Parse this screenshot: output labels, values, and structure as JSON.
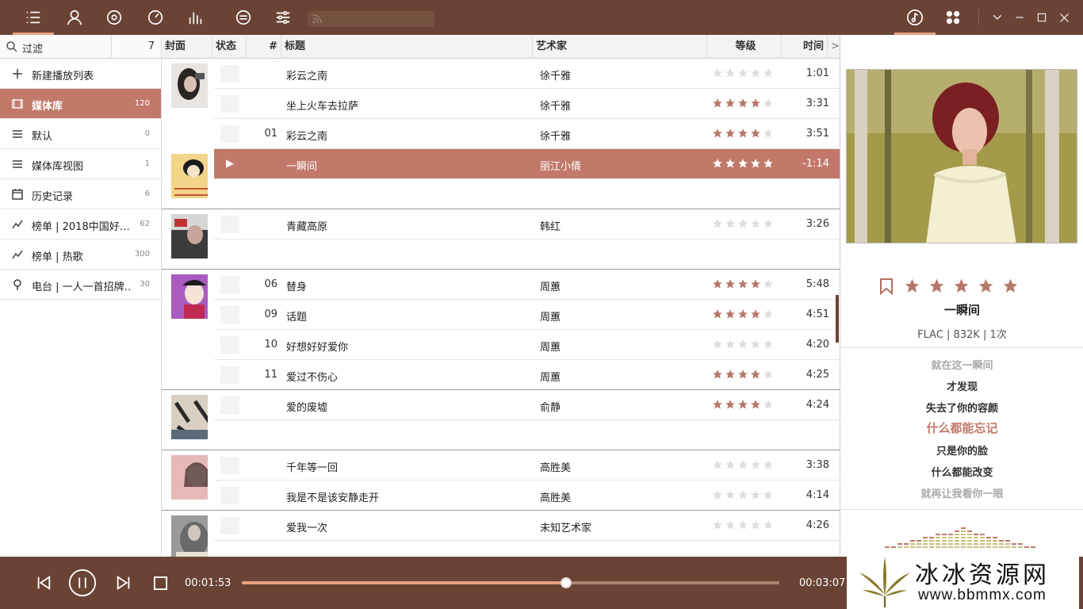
{
  "toolbar": {
    "icons": [
      "menu-list-icon",
      "user-icon",
      "disc-icon",
      "clock-icon",
      "equalizer-icon",
      "minus-circle-icon",
      "sliders-icon"
    ],
    "right_icons": [
      "music-note-icon",
      "grid-icon"
    ],
    "window_controls": [
      "chevron-down-icon",
      "minimize-icon",
      "maximize-icon",
      "close-icon"
    ],
    "search_placeholder": "",
    "accent": "#e9a07f",
    "bar_color": "#6a4335"
  },
  "sidebar": {
    "filter_label": "过滤",
    "filter_count": "7",
    "items": [
      {
        "label": "新建播放列表",
        "count": "",
        "icon": "plus-icon"
      },
      {
        "label": "媒体库",
        "count": "120",
        "icon": "library-icon"
      },
      {
        "label": "默认",
        "count": "0",
        "icon": "list-icon"
      },
      {
        "label": "媒体库视图",
        "count": "1",
        "icon": "list-icon"
      },
      {
        "label": "历史记录",
        "count": "6",
        "icon": "calendar-icon"
      },
      {
        "label": "榜单 | 2018中国好…",
        "count": "62",
        "icon": "trend-icon"
      },
      {
        "label": "榜单 | 热歌",
        "count": "300",
        "icon": "trend-icon"
      },
      {
        "label": "电台 | 一人一首招牌…",
        "count": "30",
        "icon": "radio-icon"
      }
    ]
  },
  "table": {
    "headers": {
      "cover": "封面",
      "status": "状态",
      "num": "#",
      "title": "标题",
      "artist": "艺术家",
      "rating": "等级",
      "time": "时间",
      "more": ">"
    },
    "rows": [
      {
        "num": "",
        "title": "彩云之南",
        "artist": "徐千雅",
        "rating": 0,
        "time": "1:01"
      },
      {
        "num": "",
        "title": "坐上火车去拉萨",
        "artist": "徐千雅",
        "rating": 4,
        "time": "3:31"
      },
      {
        "num": "01",
        "title": "彩云之南",
        "artist": "徐千雅",
        "rating": 4,
        "time": "3:51"
      },
      {
        "num": "",
        "title": "一瞬间",
        "artist": "丽江小倩",
        "rating": 5,
        "time": "-1:14",
        "playing": true,
        "status": "▶"
      },
      {
        "num": "",
        "title": "青藏高原",
        "artist": "韩红",
        "rating": 0,
        "time": "3:26"
      },
      {
        "num": "06",
        "title": "替身",
        "artist": "周蕙",
        "rating": 4,
        "time": "5:48"
      },
      {
        "num": "09",
        "title": "话题",
        "artist": "周蕙",
        "rating": 4,
        "time": "4:51"
      },
      {
        "num": "10",
        "title": "好想好好爱你",
        "artist": "周蕙",
        "rating": 0,
        "time": "4:20"
      },
      {
        "num": "11",
        "title": "爱过不伤心",
        "artist": "周蕙",
        "rating": 4,
        "time": "4:25"
      },
      {
        "num": "",
        "title": "爱的废墟",
        "artist": "俞静",
        "rating": 4,
        "time": "4:24"
      },
      {
        "num": "",
        "title": "千年等一回",
        "artist": "高胜美",
        "rating": 0,
        "time": "3:38"
      },
      {
        "num": "",
        "title": "我是不是该安静走开",
        "artist": "高胜美",
        "rating": 0,
        "time": "4:14"
      },
      {
        "num": "",
        "title": "爱我一次",
        "artist": "未知艺术家",
        "rating": 0,
        "time": "4:26"
      }
    ]
  },
  "now_playing": {
    "title": "一瞬间",
    "info": "FLAC | 832K | 1次",
    "rating": 5,
    "lyrics": [
      "就在这一瞬间",
      "才发现",
      "失去了你的容颜",
      "什么都能忘记",
      "只是你的脸",
      "什么都能改变",
      "就再让我看你一眼"
    ],
    "current_lyric_index": 3
  },
  "player": {
    "elapsed": "00:01:53",
    "total": "00:03:07",
    "progress": 0.603
  },
  "watermark": {
    "line1": "冰冰资源网",
    "line2": "www.bbmmx.com"
  }
}
